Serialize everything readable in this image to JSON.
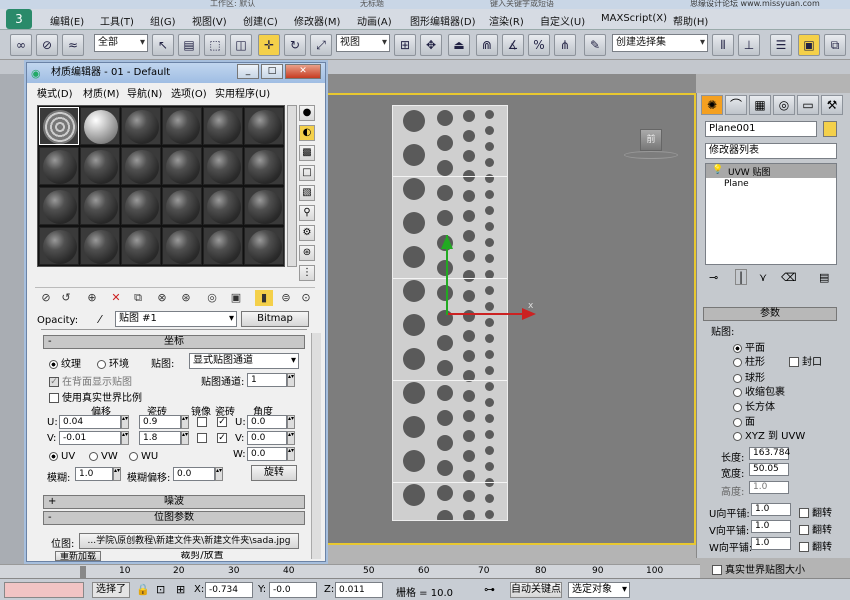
{
  "titlebar": {
    "workspace": "工作区: 默认",
    "search": "键入关键字或短语",
    "watermark": "思缘设计论坛 www.missyuan.com",
    "file_name": "无标题"
  },
  "menu": [
    "编辑(E)",
    "工具(T)",
    "组(G)",
    "视图(V)",
    "创建(C)",
    "修改器(M)",
    "动画(A)",
    "图形编辑器(D)",
    "渲染(R)",
    "自定义(U)",
    "MAXScript(X)",
    "帮助(H)"
  ],
  "toolbar": {
    "filter": "全部",
    "ref_coord": "视图",
    "selection_set": "创建选择集"
  },
  "viewport": {
    "gizmo_label": "前",
    "axis_x": "x"
  },
  "command_panel": {
    "object_name": "Plane001",
    "modifier_list": "修改器列表",
    "stack": [
      "UVW 贴图",
      "Plane"
    ],
    "params_title": "参数",
    "mapping_label": "贴图:",
    "mapping_types": [
      "平面",
      "柱形",
      "球形",
      "收缩包裹",
      "长方体",
      "面",
      "XYZ 到 UVW"
    ],
    "cap_label": "封口",
    "length_label": "长度:",
    "length": "163.784",
    "width_label": "宽度:",
    "width": "50.05",
    "height_label": "高度:",
    "height": "1.0",
    "u_tile_label": "U向平铺:",
    "u_tile": "1.0",
    "v_tile_label": "V向平铺:",
    "v_tile": "1.0",
    "w_tile_label": "W向平铺:",
    "w_tile": "1.0",
    "flip_label": "翻转",
    "real_world": "真实世界贴图大小"
  },
  "material_editor": {
    "title": "材质编辑器 - 01 - Default",
    "menu": [
      "模式(D)",
      "材质(M)",
      "导航(N)",
      "选项(O)",
      "实用程序(U)"
    ],
    "opacity_label": "Opacity:",
    "map_name": "贴图 #1",
    "map_type": "Bitmap",
    "coords_title": "坐标",
    "texture_label": "纹理",
    "env_label": "环境",
    "map_label": "贴图:",
    "map_channel_type": "显式贴图通道",
    "show_back": "在背面显示贴图",
    "map_channel_label": "贴图通道:",
    "map_channel": "1",
    "real_world": "使用真实世界比例",
    "offset_label": "偏移",
    "tiling_label": "瓷砖",
    "mirror_label": "镜像",
    "tile_label": "瓷砖",
    "angle_label": "角度",
    "u_offset": "0.04",
    "v_offset": "-0.01",
    "u_tiling": "0.9",
    "v_tiling": "1.8",
    "u_angle": "0.0",
    "v_angle": "0.0",
    "w_angle": "0.0",
    "uv": "UV",
    "vw": "VW",
    "wu": "WU",
    "blur_label": "模糊:",
    "blur": "1.0",
    "blur_offset_label": "模糊偏移:",
    "blur_offset": "0.0",
    "rotate": "旋转",
    "noise_title": "噪波",
    "bitmap_params_title": "位图参数",
    "bitmap_label": "位图:",
    "bitmap_path": "...学院\\原创教程\\新建文件夹\\新建文件夹\\sada.jpg",
    "reload": "重新加载",
    "crop": "裁剪/放置"
  },
  "status": {
    "selected": "选择了",
    "x_label": "X:",
    "x": "-0.734",
    "y_label": "Y:",
    "y": "-0.0",
    "z_label": "Z:",
    "z": "0.011",
    "grid": "栅格 = 10.0",
    "autokey": "自动关键点",
    "set_key": "选定对象",
    "frame_ticks": [
      "10",
      "20",
      "30",
      "40",
      "50",
      "60",
      "70",
      "80",
      "90",
      "100"
    ]
  }
}
